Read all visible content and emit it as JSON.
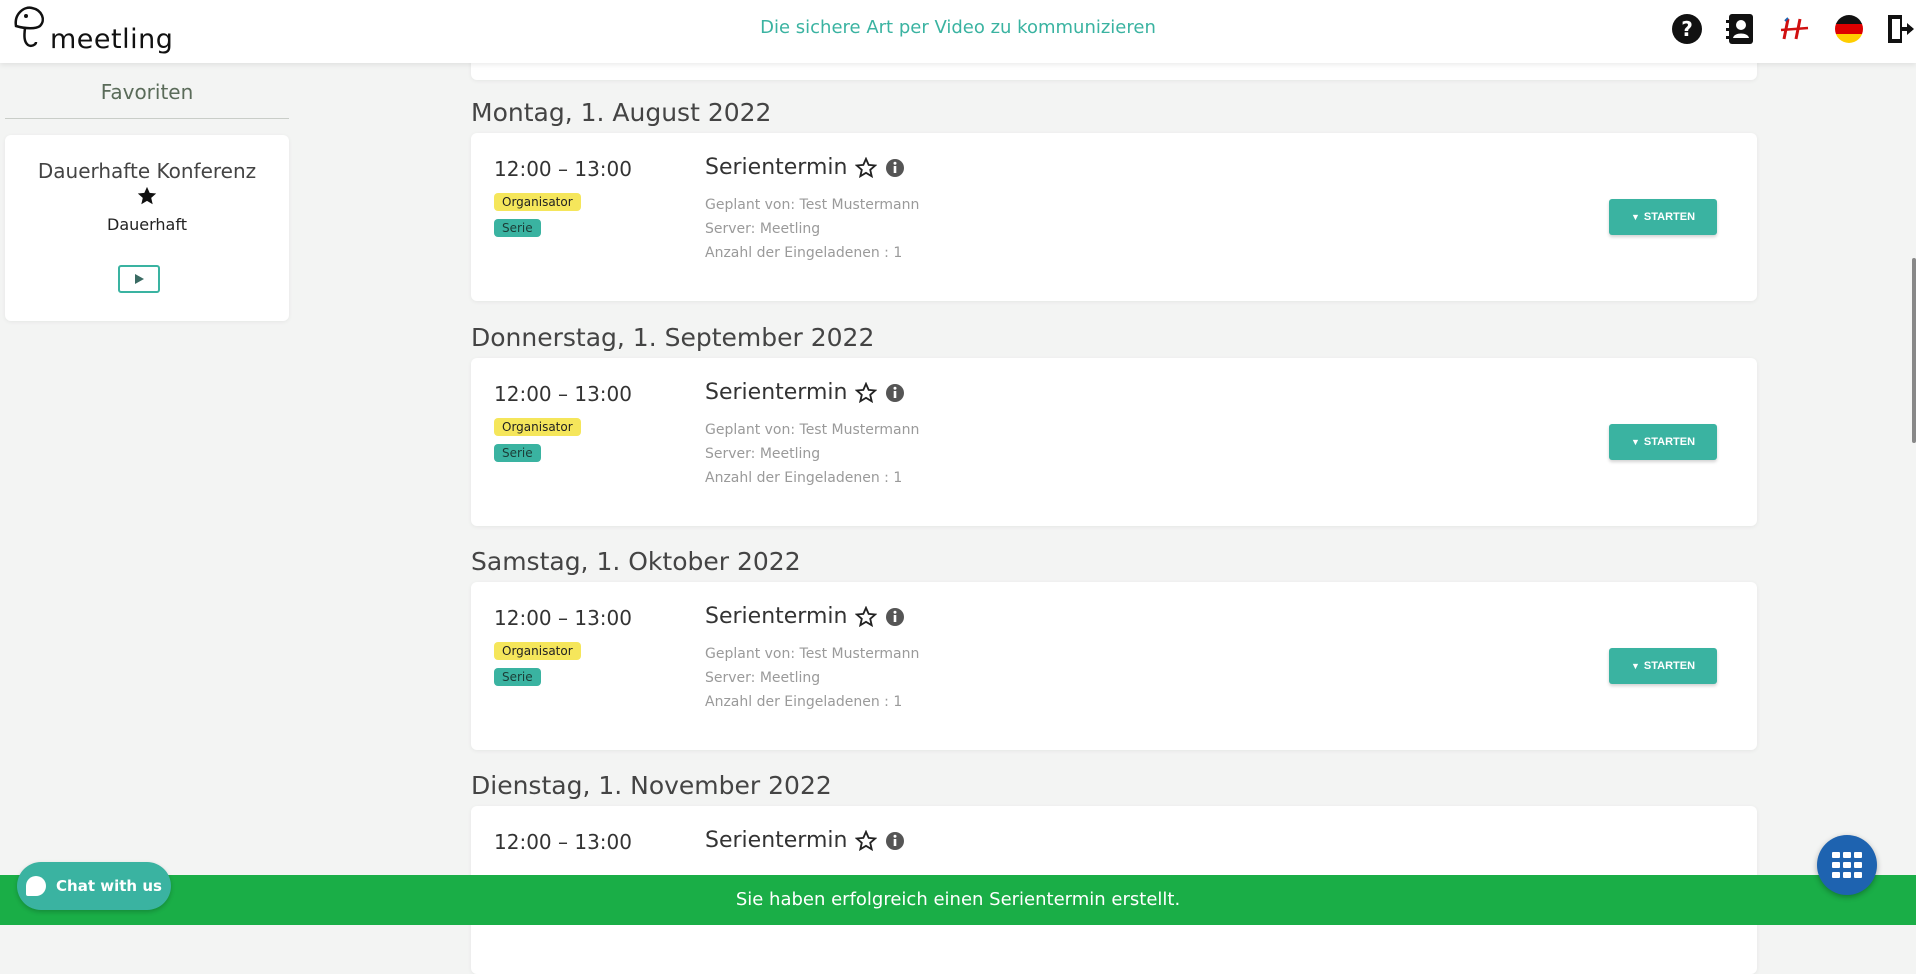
{
  "header": {
    "logo_text": "meetling",
    "tagline": "Die sichere Art per Video zu kommunizieren",
    "icons": [
      "help-icon",
      "contacts-icon",
      "brand-h-icon",
      "german-flag-icon",
      "logout-icon"
    ]
  },
  "sidebar": {
    "title": "Favoriten",
    "favorite": {
      "title": "Dauerhafte Konferenz",
      "subtitle": "Dauerhaft",
      "star_icon": "star-filled-icon",
      "play_icon": "play-icon"
    }
  },
  "days": [
    {
      "heading": "Montag, 1. August 2022",
      "event": {
        "time": "12:00 – 13:00",
        "badge_org": "Organisator",
        "badge_series": "Serie",
        "title": "Serientermin",
        "planned_by": "Geplant von: Test Mustermann",
        "server": "Server: Meetling",
        "invited": "Anzahl der Eingeladenen : 1",
        "start_label": "STARTEN"
      }
    },
    {
      "heading": "Donnerstag, 1. September 2022",
      "event": {
        "time": "12:00 – 13:00",
        "badge_org": "Organisator",
        "badge_series": "Serie",
        "title": "Serientermin",
        "planned_by": "Geplant von: Test Mustermann",
        "server": "Server: Meetling",
        "invited": "Anzahl der Eingeladenen : 1",
        "start_label": "STARTEN"
      }
    },
    {
      "heading": "Samstag, 1. Oktober 2022",
      "event": {
        "time": "12:00 – 13:00",
        "badge_org": "Organisator",
        "badge_series": "Serie",
        "title": "Serientermin",
        "planned_by": "Geplant von: Test Mustermann",
        "server": "Server: Meetling",
        "invited": "Anzahl der Eingeladenen : 1",
        "start_label": "STARTEN"
      }
    },
    {
      "heading": "Dienstag, 1. November 2022",
      "event": {
        "time": "12:00 – 13:00",
        "title": "Serientermin"
      }
    }
  ],
  "chat": {
    "label": "Chat with us"
  },
  "notification": {
    "text": "Sie haben erfolgreich einen Serientermin erstellt."
  },
  "colors": {
    "accent": "#3ab3a1",
    "success": "#1aae47",
    "badge_org": "#f5e65b",
    "grid_button": "#1e63b0"
  }
}
